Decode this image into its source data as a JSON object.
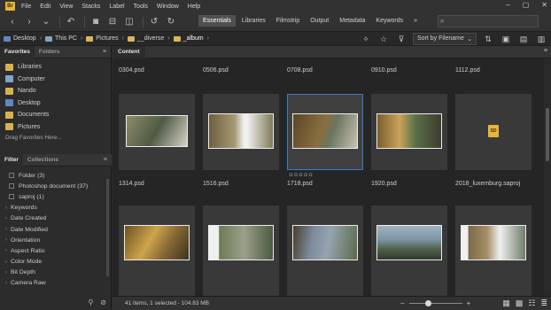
{
  "menu": {
    "logo": "Br",
    "items": [
      "File",
      "Edit",
      "View",
      "Stacks",
      "Label",
      "Tools",
      "Window",
      "Help"
    ]
  },
  "toolbar": {
    "workspaces": [
      "Essentials",
      "Libraries",
      "Filmstrip",
      "Output",
      "Metadata",
      "Keywords"
    ],
    "active_workspace": "Essentials",
    "search_placeholder": ""
  },
  "path": {
    "crumbs": [
      "Desktop",
      "This PC",
      "Pictures",
      "__diverse",
      "_album"
    ],
    "sort_label": "Sort by Filename"
  },
  "left": {
    "tabs": [
      "Favorites",
      "Folders"
    ],
    "favorites": [
      {
        "label": "Libraries",
        "color": "#d7b34e"
      },
      {
        "label": "Computer",
        "color": "#7fa6c9"
      },
      {
        "label": "Nando",
        "color": "#d7b34e"
      },
      {
        "label": "Desktop",
        "color": "#5e88c4"
      },
      {
        "label": "Documents",
        "color": "#d7b34e"
      },
      {
        "label": "Pictures",
        "color": "#d7b34e"
      }
    ],
    "favorites_hint": "Drag Favorites Here...",
    "filter_tabs": [
      "Filter",
      "Collections"
    ],
    "file_type_items": [
      "Folder (3)",
      "Photoshop document (37)",
      "saproj (1)"
    ],
    "filter_groups": [
      "Keywords",
      "Date Created",
      "Date Modified",
      "Orientation",
      "Aspect Ratio",
      "Color Mode",
      "Bit Depth",
      "Camera Raw"
    ]
  },
  "content": {
    "tab": "Content",
    "row_top_names": [
      "0304.psd",
      "0506.psd",
      "0708.psd",
      "0910.psd",
      "1112.psd"
    ],
    "row_mid_names": [
      "1314.psd",
      "1516.psd",
      "1718.psd",
      "1920.psd",
      "2018_luxemburg.saproj"
    ],
    "selected_file": "0708.psd",
    "selected_rating": "✩✩✩✩✩",
    "saproj_badge": "SD"
  },
  "status": {
    "text": "41 items, 1 selected - 104.83 MB"
  },
  "colors": {
    "selection": "#3b7bd0",
    "accent": "#e8b43a"
  }
}
